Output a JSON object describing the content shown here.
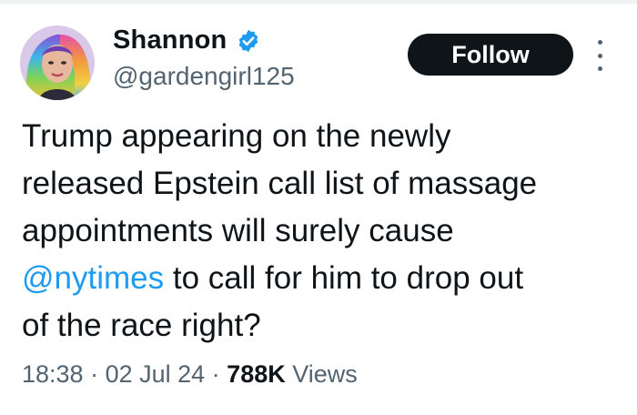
{
  "user": {
    "display_name": "Shannon",
    "handle": "@gardengirl125",
    "verified": true,
    "avatar_icon": "profile-photo-rainbow-hair"
  },
  "actions": {
    "follow_label": "Follow",
    "more_icon": "vertical-ellipsis-icon"
  },
  "tweet": {
    "line1": "Trump appearing on the newly",
    "line2": "released Epstein call list of massage",
    "line3": "appointments will surely cause",
    "mention": "@nytimes",
    "line4_rest": " to call for him to drop out",
    "line5": "of the race right?"
  },
  "meta": {
    "time": "18:38",
    "separator": " · ",
    "date": "02 Jul 24",
    "views_count": "788K",
    "views_label": " Views"
  },
  "colors": {
    "accent": "#1d9bf0",
    "text": "#0f1419",
    "secondary": "#536471",
    "button_bg": "#0f1419"
  }
}
